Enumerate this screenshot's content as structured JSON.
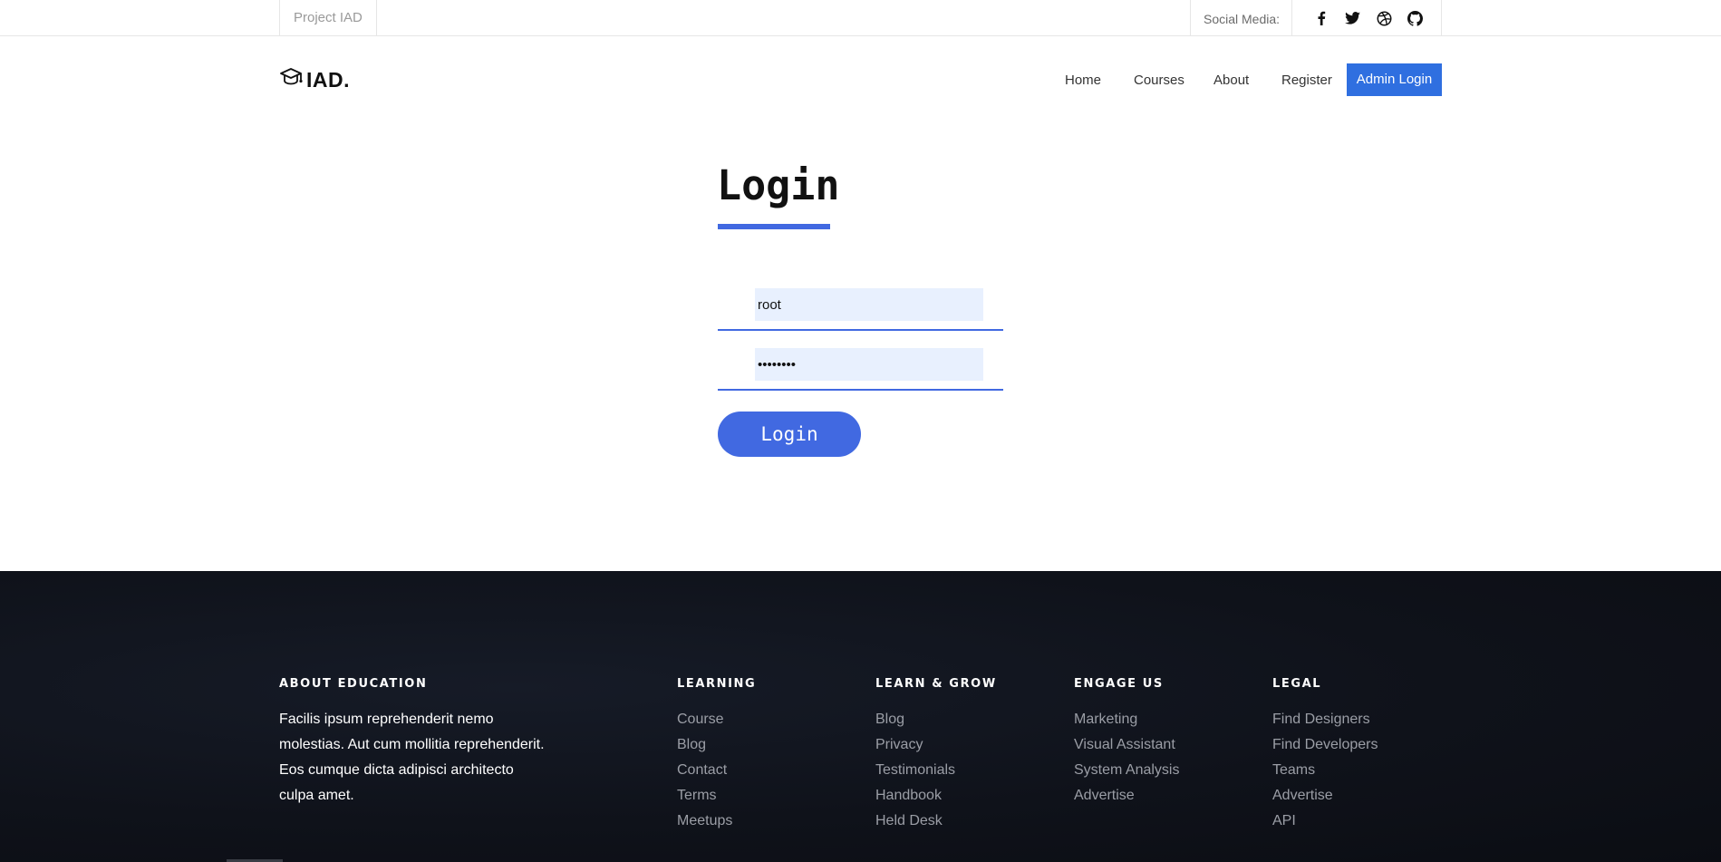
{
  "topbar": {
    "project_label": "Project IAD",
    "social_label": "Social Media:",
    "icons": [
      "facebook-icon",
      "twitter-icon",
      "dribbble-icon",
      "github-icon"
    ]
  },
  "header": {
    "logo_text": "IAD.",
    "nav": [
      "Home",
      "Courses",
      "About",
      "Register"
    ],
    "admin_button": "Admin Login"
  },
  "login": {
    "title": "Login",
    "username_value": "root",
    "password_value": "••••••••",
    "submit_label": "Login"
  },
  "footer": {
    "about": {
      "heading": "ABOUT EDUCATION",
      "text": "Facilis ipsum reprehenderit nemo molestias. Aut cum mollitia reprehenderit. Eos cumque dicta adipisci architecto culpa amet."
    },
    "columns": [
      {
        "heading": "LEARNING",
        "links": [
          "Course",
          "Blog",
          "Contact",
          "Terms",
          "Meetups"
        ]
      },
      {
        "heading": "LEARN & GROW",
        "links": [
          "Blog",
          "Privacy",
          "Testimonials",
          "Handbook",
          "Held Desk"
        ]
      },
      {
        "heading": "ENGAGE US",
        "links": [
          "Marketing",
          "Visual Assistant",
          "System Analysis",
          "Advertise"
        ]
      },
      {
        "heading": "LEGAL",
        "links": [
          "Find Designers",
          "Find Developers",
          "Teams",
          "Advertise",
          "API"
        ]
      }
    ]
  },
  "colors": {
    "accent": "#4169e1",
    "admin_button": "#2f6fe0",
    "footer_bg": "#0f121a",
    "input_bg": "#e8f0fe"
  }
}
